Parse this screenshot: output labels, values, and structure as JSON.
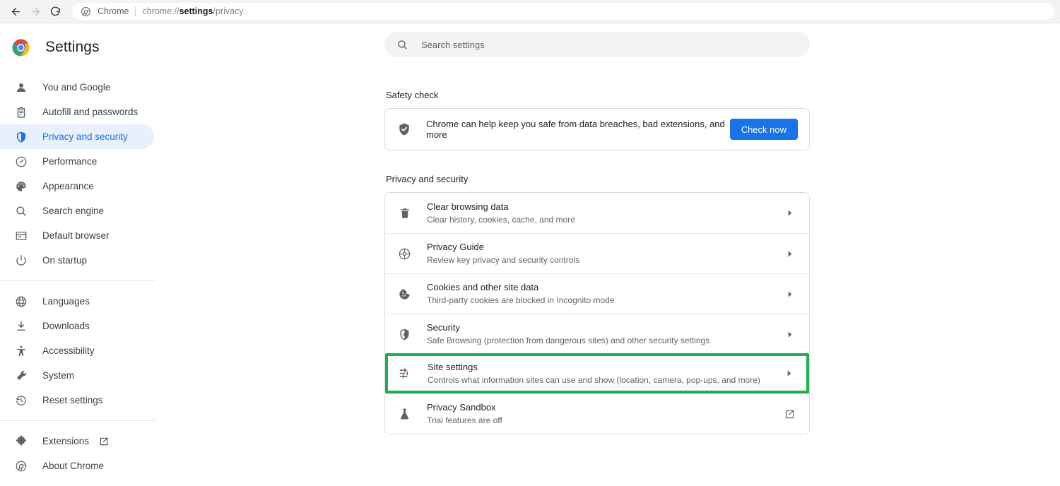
{
  "browser": {
    "back_icon": "back-arrow-icon",
    "forward_icon": "forward-arrow-icon",
    "reload_icon": "reload-icon",
    "omnibox": {
      "chrome_label": "Chrome",
      "url_prefix": "chrome://",
      "url_bold": "settings",
      "url_suffix": "/privacy"
    }
  },
  "sidebar": {
    "title": "Settings",
    "items": [
      {
        "label": "You and Google",
        "icon": "person-icon",
        "active": false,
        "external": false
      },
      {
        "label": "Autofill and passwords",
        "icon": "clipboard-icon",
        "active": false,
        "external": false
      },
      {
        "label": "Privacy and security",
        "icon": "shield-icon",
        "active": true,
        "external": false
      },
      {
        "label": "Performance",
        "icon": "speedometer-icon",
        "active": false,
        "external": false
      },
      {
        "label": "Appearance",
        "icon": "palette-icon",
        "active": false,
        "external": false
      },
      {
        "label": "Search engine",
        "icon": "magnifier-icon",
        "active": false,
        "external": false
      },
      {
        "label": "Default browser",
        "icon": "browser-window-icon",
        "active": false,
        "external": false
      },
      {
        "label": "On startup",
        "icon": "power-icon",
        "active": false,
        "external": false
      },
      {
        "divider": true
      },
      {
        "label": "Languages",
        "icon": "globe-icon",
        "active": false,
        "external": false
      },
      {
        "label": "Downloads",
        "icon": "download-icon",
        "active": false,
        "external": false
      },
      {
        "label": "Accessibility",
        "icon": "accessibility-icon",
        "active": false,
        "external": false
      },
      {
        "label": "System",
        "icon": "wrench-icon",
        "active": false,
        "external": false
      },
      {
        "label": "Reset settings",
        "icon": "history-restore-icon",
        "active": false,
        "external": false
      },
      {
        "divider": true
      },
      {
        "label": "Extensions",
        "icon": "puzzle-piece-icon",
        "active": false,
        "external": true
      },
      {
        "label": "About Chrome",
        "icon": "chrome-outline-icon",
        "active": false,
        "external": false
      }
    ]
  },
  "search": {
    "placeholder": "Search settings",
    "icon": "search-icon"
  },
  "safety_check": {
    "section_title": "Safety check",
    "icon": "shield-check-icon",
    "description": "Chrome can help keep you safe from data breaches, bad extensions, and more",
    "button_label": "Check now",
    "button_color": "#1a73e8"
  },
  "privacy_section": {
    "section_title": "Privacy and security",
    "highlight_color": "#1cb050",
    "rows": [
      {
        "icon": "trash-icon",
        "title": "Clear browsing data",
        "subtitle": "Clear history, cookies, cache, and more",
        "end_icon": "chevron-right-icon",
        "highlighted": false
      },
      {
        "icon": "privacy-guide-icon",
        "title": "Privacy Guide",
        "subtitle": "Review key privacy and security controls",
        "end_icon": "chevron-right-icon",
        "highlighted": false
      },
      {
        "icon": "cookie-icon",
        "title": "Cookies and other site data",
        "subtitle": "Third-party cookies are blocked in Incognito mode",
        "end_icon": "chevron-right-icon",
        "highlighted": false
      },
      {
        "icon": "shield-lock-icon",
        "title": "Security",
        "subtitle": "Safe Browsing (protection from dangerous sites) and other security settings",
        "end_icon": "chevron-right-icon",
        "highlighted": false
      },
      {
        "icon": "sliders-icon",
        "title": "Site settings",
        "subtitle": "Controls what information sites can use and show (location, camera, pop-ups, and more)",
        "end_icon": "chevron-right-icon",
        "highlighted": true
      },
      {
        "icon": "flask-icon",
        "title": "Privacy Sandbox",
        "subtitle": "Trial features are off",
        "end_icon": "external-link-icon",
        "highlighted": false
      }
    ]
  }
}
